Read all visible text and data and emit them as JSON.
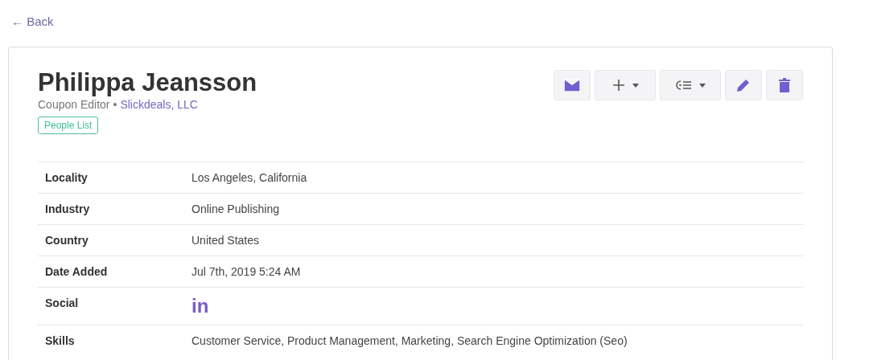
{
  "back_link": "← Back",
  "person": {
    "name": "Philippa Jeansson",
    "title": "Coupon Editor",
    "separator": "•",
    "company": "Slickdeals, LLC",
    "tag": "People List"
  },
  "actions": [
    {
      "kind": "email",
      "dropdown": false
    },
    {
      "kind": "add",
      "dropdown": true
    },
    {
      "kind": "sequence",
      "dropdown": true
    },
    {
      "kind": "edit",
      "dropdown": false
    },
    {
      "kind": "delete",
      "dropdown": false
    }
  ],
  "details": [
    {
      "kind": "text",
      "label": "Locality",
      "value": "Los Angeles, California"
    },
    {
      "kind": "text",
      "label": "Industry",
      "value": "Online Publishing"
    },
    {
      "kind": "text",
      "label": "Country",
      "value": "United States"
    },
    {
      "kind": "text",
      "label": "Date Added",
      "value": "Jul 7th, 2019 5:24 AM"
    },
    {
      "kind": "social",
      "label": "Social",
      "value": "in"
    },
    {
      "kind": "text",
      "label": "Skills",
      "value": "Customer Service, Product Management, Marketing, Search Engine Optimization (Seo)"
    }
  ]
}
